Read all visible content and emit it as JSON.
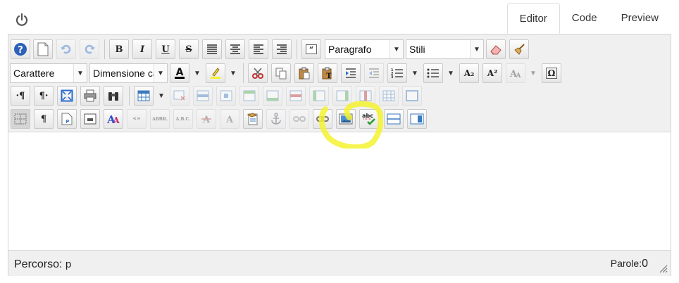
{
  "tabs": {
    "editor": "Editor",
    "code": "Code",
    "preview": "Preview"
  },
  "toolbar": {
    "format_select": "Paragrafo",
    "style_select": "Stili",
    "font_select": "Carattere",
    "size_select": "Dimensione ca",
    "bold": "B",
    "italic": "I",
    "underline": "U",
    "strike": "S",
    "subscript": "A₂",
    "superscript": "A²",
    "omega": "Ω",
    "show_blocks": "¶",
    "ltr": "·¶",
    "rtl": "¶·",
    "citation": "«»",
    "abbr": "ABBR.",
    "acronym": "A.B.C.",
    "spell": "abc"
  },
  "status": {
    "path_label": "Percorso:",
    "path_value": "p",
    "words_label": "Parole:",
    "words_value": "0"
  },
  "colors": {
    "accent": "#f5f230",
    "toolbar_bg": "#f0f0f0",
    "border": "#d4d4d4"
  }
}
